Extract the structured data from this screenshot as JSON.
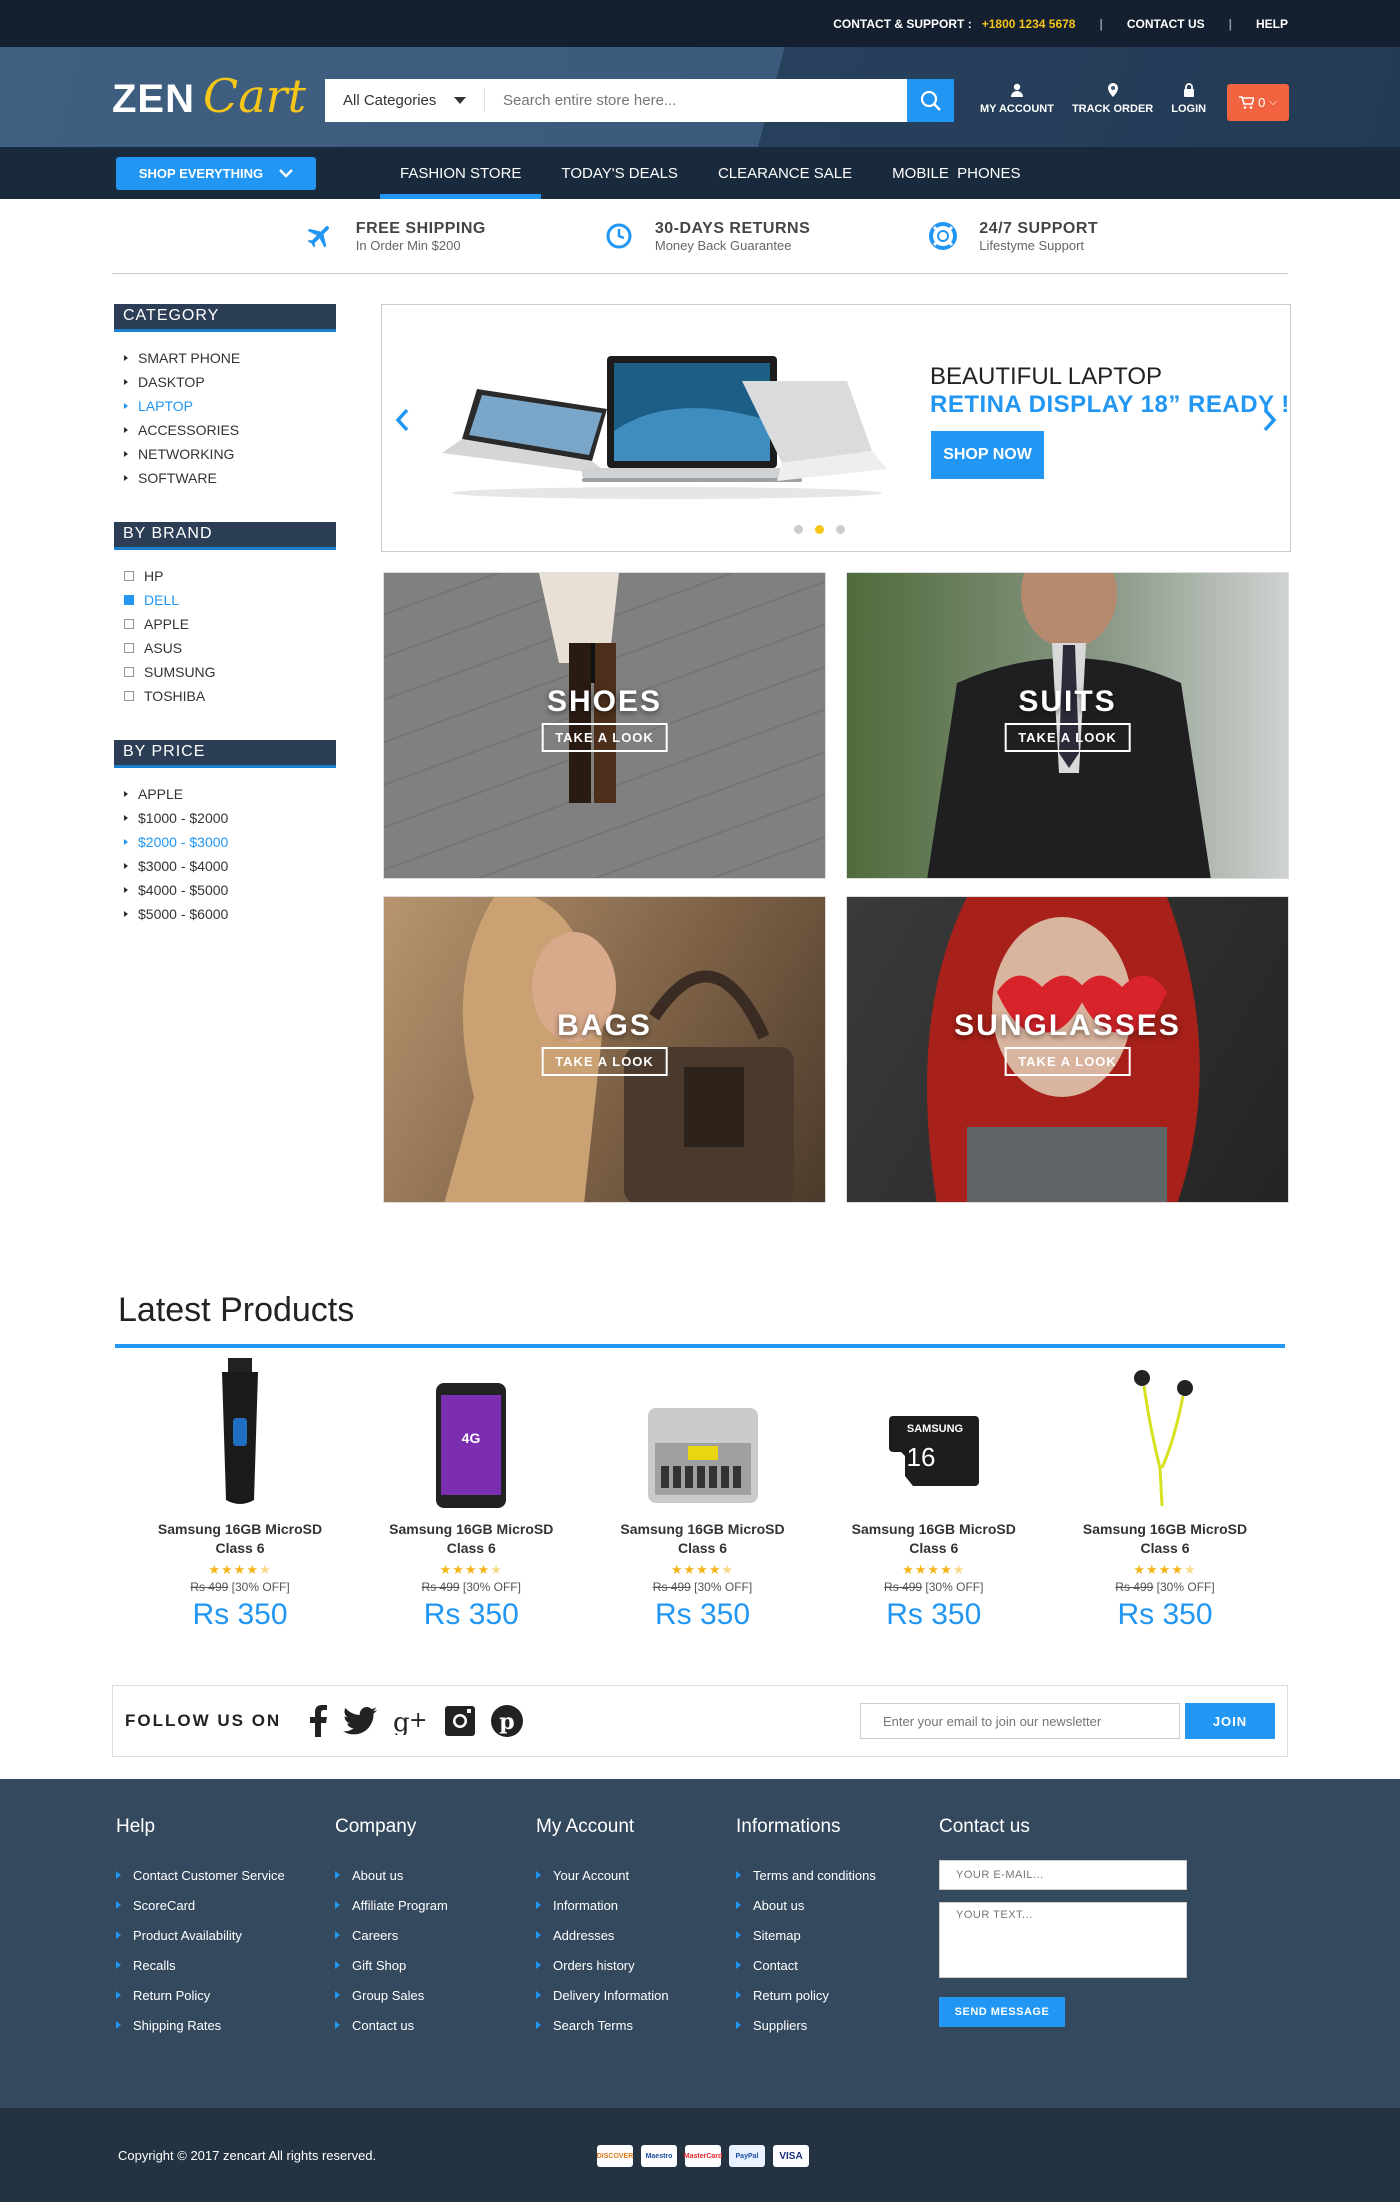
{
  "topbar": {
    "support_label": "CONTACT & SUPPORT :",
    "phone": "+1800 1234 5678",
    "contact_us": "CONTACT US",
    "help": "HELP"
  },
  "brand": {
    "name_part1": "ZEN",
    "name_part2": "Cart"
  },
  "search": {
    "category": "All Categories",
    "placeholder": "Search entire store here...",
    "icon": "search-icon"
  },
  "header_links": [
    {
      "label": "MY ACCOUNT",
      "icon": "user-icon"
    },
    {
      "label": "TRACK ORDER",
      "icon": "location-pin-icon"
    },
    {
      "label": "LOGIN",
      "icon": "lock-icon"
    }
  ],
  "cart": {
    "count": "0",
    "icon": "cart-icon"
  },
  "nav": {
    "shop_everything": "SHOP EVERYTHING",
    "links": [
      "FASHION STORE",
      "TODAY'S DEALS",
      "CLEARANCE SALE",
      "MOBILE  PHONES"
    ],
    "active_index": 0
  },
  "features": [
    {
      "title": "FREE SHIPPING",
      "subtitle": "In Order Min $200",
      "icon": "airplane-icon"
    },
    {
      "title": "30-DAYS RETURNS",
      "subtitle": "Money Back  Guarantee",
      "icon": "clock-icon"
    },
    {
      "title": "24/7 SUPPORT",
      "subtitle": "Lifestyme Support",
      "icon": "lifebuoy-icon"
    }
  ],
  "sidebar": {
    "category": {
      "title": "CATEGORY",
      "items": [
        "SMART PHONE",
        "DASKTOP",
        "LAPTOP",
        "ACCESSORIES",
        "NETWORKING",
        "SOFTWARE"
      ],
      "active": 2
    },
    "brand": {
      "title": "BY BRAND",
      "items": [
        "HP",
        "DELL",
        "APPLE",
        "ASUS",
        "SUMSUNG",
        "TOSHIBA"
      ],
      "checked": 1
    },
    "price": {
      "title": "BY PRICE",
      "items": [
        "APPLE",
        "$1000 - $2000",
        "$2000 - $3000",
        "$3000 - $4000",
        "$4000 - $5000",
        "$5000 - $6000"
      ],
      "active": 2
    }
  },
  "banner": {
    "line1": "BEAUTIFUL LAPTOP",
    "line2": "RETINA DISPLAY 18” READY !",
    "cta": "SHOP NOW",
    "slides": 3,
    "active_slide": 1
  },
  "tiles": [
    {
      "name": "SHOES",
      "cta": "TAKE A LOOK"
    },
    {
      "name": "SUITS",
      "cta": "TAKE A LOOK"
    },
    {
      "name": "BAGS",
      "cta": "TAKE A LOOK"
    },
    {
      "name": "SUNGLASSES",
      "cta": "TAKE A LOOK"
    }
  ],
  "latest": {
    "title": "Latest Products",
    "products": [
      {
        "name": "Samsung 16GB MicroSD Class 6",
        "rating": 4.5,
        "old_price": "Rs 499",
        "discount": "[30% OFF]",
        "price": "Rs 350",
        "image": "beard-trimmer"
      },
      {
        "name": "Samsung 16GB MicroSD Class 6",
        "rating": 4.5,
        "old_price": "Rs 499",
        "discount": "[30% OFF]",
        "price": "Rs 350",
        "image": "smartphone"
      },
      {
        "name": "Samsung 16GB MicroSD Class 6",
        "rating": 4.5,
        "old_price": "Rs 499",
        "discount": "[30% OFF]",
        "price": "Rs 350",
        "image": "tool-kit"
      },
      {
        "name": "Samsung 16GB MicroSD Class 6",
        "rating": 4.5,
        "old_price": "Rs 499",
        "discount": "[30% OFF]",
        "price": "Rs 350",
        "image": "memory-card"
      },
      {
        "name": "Samsung 16GB MicroSD Class 6",
        "rating": 4.5,
        "old_price": "Rs 499",
        "discount": "[30% OFF]",
        "price": "Rs 350",
        "image": "earphones"
      }
    ]
  },
  "follow": {
    "title": "FOLLOW US ON",
    "social": [
      "facebook-icon",
      "twitter-icon",
      "google-plus-icon",
      "instagram-icon",
      "pinterest-icon"
    ],
    "newsletter_placeholder": "Enter your email to join our newsletter",
    "join": "JOIN"
  },
  "footer": {
    "columns": [
      {
        "title": "Help",
        "items": [
          "Contact Customer Service",
          "ScoreCard",
          "Product Availability",
          "Recalls",
          "Return Policy",
          "Shipping Rates"
        ]
      },
      {
        "title": "Company",
        "items": [
          "About us",
          "Affiliate Program",
          "Careers",
          "Gift Shop",
          "Group Sales",
          "Contact us"
        ]
      },
      {
        "title": "My Account",
        "items": [
          "Your Account",
          "Information",
          "Addresses",
          "Orders history",
          "Delivery Information",
          "Search Terms"
        ]
      },
      {
        "title": "Informations",
        "items": [
          "Terms and conditions",
          "About us",
          "Sitemap",
          "Contact",
          "Return policy",
          "Suppliers"
        ]
      }
    ],
    "contact": {
      "title": "Contact us",
      "email_placeholder": "YOUR E-MAIL...",
      "text_placeholder": "YOUR TEXT...",
      "send": "SEND MESSAGE"
    },
    "copyright": "Copyright © 2017 zencart All rights reserved.",
    "payments": [
      "DISCOVER",
      "Maestro",
      "MasterCard",
      "PayPal",
      "VISA"
    ]
  },
  "colors": {
    "accent": "#2196f3",
    "dark": "#14202f",
    "footer": "#34495e",
    "star": "#f5b418",
    "cart": "#f2633f"
  }
}
